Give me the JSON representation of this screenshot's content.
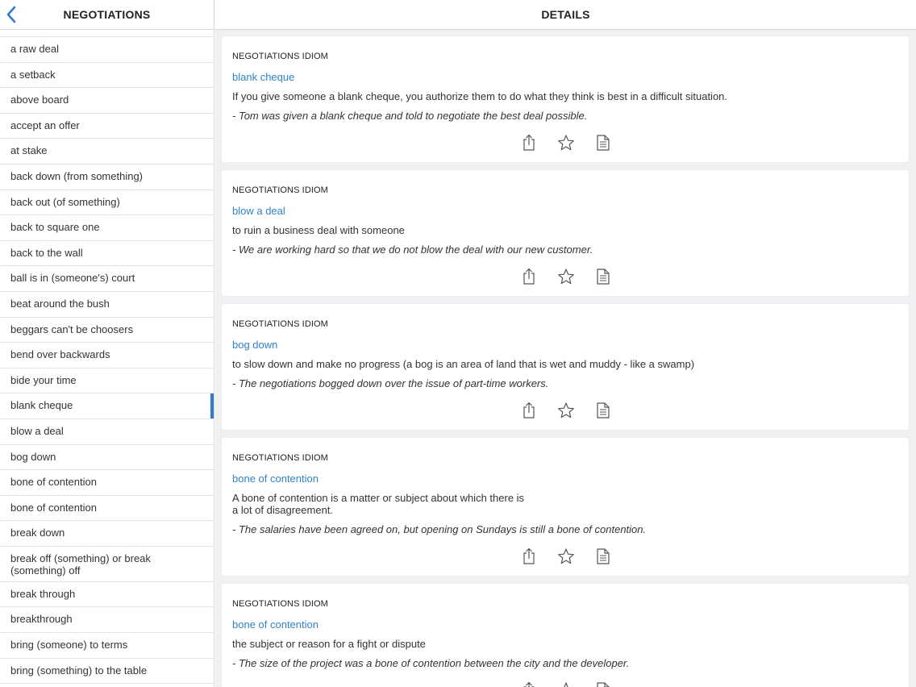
{
  "left": {
    "title": "NEGOTIATIONS",
    "items": [
      {
        "label": "a raw deal"
      },
      {
        "label": "a setback"
      },
      {
        "label": "above board"
      },
      {
        "label": "accept an offer"
      },
      {
        "label": "at stake"
      },
      {
        "label": "back down (from something)"
      },
      {
        "label": "back out (of something)"
      },
      {
        "label": "back to square one"
      },
      {
        "label": "back to the wall"
      },
      {
        "label": "ball is in (someone's) court"
      },
      {
        "label": "beat around the bush"
      },
      {
        "label": "beggars can't be choosers"
      },
      {
        "label": "bend over backwards"
      },
      {
        "label": "bide your time"
      },
      {
        "label": "blank cheque",
        "selected": true
      },
      {
        "label": "blow a deal"
      },
      {
        "label": "bog down"
      },
      {
        "label": "bone of contention"
      },
      {
        "label": "bone of contention"
      },
      {
        "label": "break down"
      },
      {
        "label": "break off (something) or break (something) off"
      },
      {
        "label": "break through"
      },
      {
        "label": "breakthrough"
      },
      {
        "label": "bring (someone) to terms"
      },
      {
        "label": "bring (something) to the table"
      }
    ]
  },
  "right": {
    "title": "DETAILS",
    "cards": [
      {
        "category": "NEGOTIATIONS IDIOM",
        "term": "blank cheque",
        "definition": "If you give someone a blank cheque, you authorize them to do what they think is best in a difficult situation.",
        "example": "- Tom was given a blank cheque and told to negotiate the best deal possible."
      },
      {
        "category": "NEGOTIATIONS IDIOM",
        "term": "blow a deal",
        "definition": "to ruin a business deal with someone",
        "example": "- We are working hard so that we do not blow the deal with our new customer."
      },
      {
        "category": "NEGOTIATIONS IDIOM",
        "term": "bog down",
        "definition": "to slow down and make no progress (a bog is an area of land that is wet and muddy - like a swamp)",
        "example": "- The negotiations bogged down over the issue of part-time workers."
      },
      {
        "category": "NEGOTIATIONS IDIOM",
        "term": "bone of contention",
        "definition": "A bone of contention is a matter or subject about which there is\na lot of disagreement.",
        "example": "- The salaries have been agreed on, but opening on Sundays is still a bone of contention."
      },
      {
        "category": "NEGOTIATIONS IDIOM",
        "term": "bone of contention",
        "definition": "the subject or reason for a fight or dispute",
        "example": "- The size of the project was a bone of contention between the city and the developer."
      }
    ]
  },
  "icons": {
    "back": "chevron-left-icon",
    "share": "share-icon",
    "favorite": "star-icon",
    "notes": "document-icon"
  },
  "colors": {
    "accent": "#2f84c9",
    "selection_bar": "#2f7bcf",
    "detail_background": "#f0f0f3"
  }
}
